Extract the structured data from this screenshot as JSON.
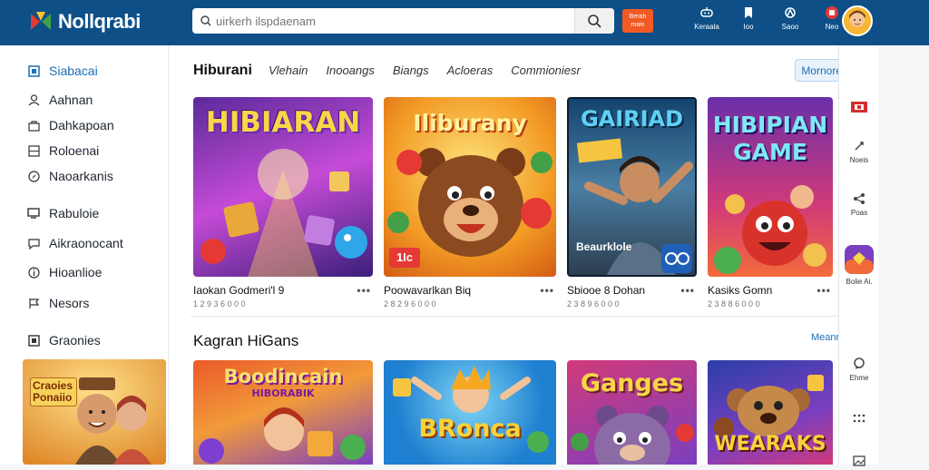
{
  "header": {
    "logo_text": "Nollqrabi",
    "search_placeholder": "uirkerh ilspdaenam",
    "promo_label": "Berah main",
    "icons": [
      {
        "name": "controller-icon",
        "label": "Keraala"
      },
      {
        "name": "bookmark-icon",
        "label": "Ioo"
      },
      {
        "name": "shop-icon",
        "label": "Saoo"
      },
      {
        "name": "notification-icon",
        "label": "Neo"
      }
    ],
    "colors": {
      "bar": "#0e4f87",
      "accent": "#f15a24"
    }
  },
  "sidebar": {
    "items": [
      {
        "label": "Siabacai",
        "icon": "home-icon",
        "active": true
      },
      {
        "label": "Aahnan",
        "icon": "person-icon"
      },
      {
        "label": "Dahkapoan",
        "icon": "bag-icon"
      },
      {
        "label": "Roloenai",
        "icon": "grid-icon"
      },
      {
        "label": "Naoarkanis",
        "icon": "compass-icon"
      },
      {
        "label": "Rabuloie",
        "icon": "monitor-icon"
      },
      {
        "label": "Aikraonocant",
        "icon": "chat-icon"
      },
      {
        "label": "Hioanlioe",
        "icon": "info-icon"
      },
      {
        "label": "Nesors",
        "icon": "flag-icon"
      },
      {
        "label": "Graonies",
        "icon": "square-icon"
      }
    ],
    "banner_text": "Craoies Ponaiio"
  },
  "main": {
    "section1": {
      "title": "Hiburani",
      "tabs": [
        "Vlehain",
        "Inooangs",
        "Biangs",
        "Acloeras",
        "Commioniesr"
      ],
      "more_label": "Mornoren",
      "cards": [
        {
          "thumb_text": "HIBIARAN",
          "title": "Iaokan Godmeri'l 9",
          "sub": "1 2 9 3 6 0 0 0"
        },
        {
          "thumb_text": "Iliburany",
          "badge": "1Ic",
          "title": "Poowavarlkan Biq",
          "sub": "2 8 2 9 6 0 0 0"
        },
        {
          "thumb_text": "GAIRIAD",
          "badge": "Beaurklole",
          "title": "Sbiooe 8 Dohan",
          "sub": "2 3 8 9 6 0 0 0"
        },
        {
          "thumb_text": "HIBIPIAN GAME",
          "title": "Kasiks Gomn",
          "sub": "2 3 8 8 6 0 0 0"
        }
      ]
    },
    "section2": {
      "title": "Kagran HiGans",
      "see_more": "Meanres",
      "cards": [
        {
          "thumb_text": "Boodincain",
          "sub_text": "HIBORABIK"
        },
        {
          "thumb_text": "BRonca"
        },
        {
          "thumb_text": "Ganges"
        },
        {
          "thumb_text": "WEARAKS"
        }
      ]
    }
  },
  "rail": {
    "items": [
      {
        "name": "flag-icon",
        "label": ""
      },
      {
        "name": "link-icon",
        "label": "Noeis"
      },
      {
        "name": "share-icon",
        "label": "Poas"
      },
      {
        "name": "game-icon",
        "label": "Bolie Ai."
      },
      {
        "name": "chat-icon",
        "label": "Ehme"
      },
      {
        "name": "apps-icon",
        "label": ""
      }
    ]
  }
}
